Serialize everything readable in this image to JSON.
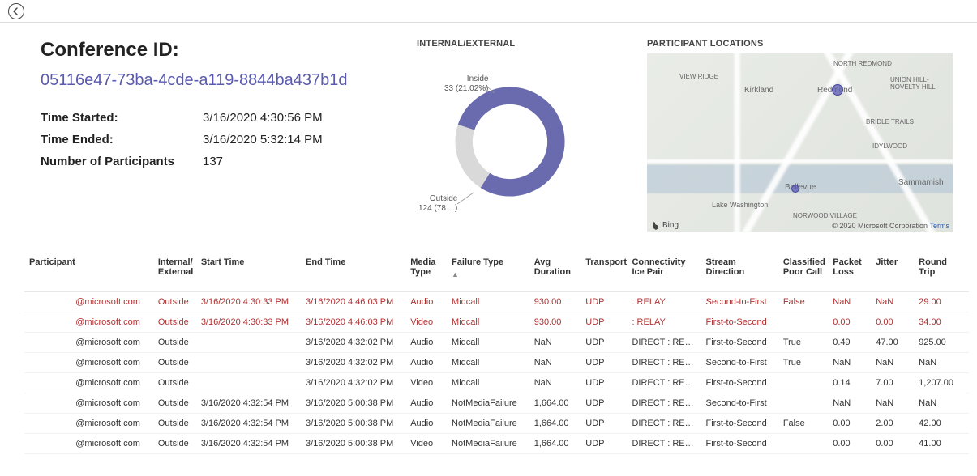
{
  "header": {
    "conf_label": "Conference ID:",
    "conf_id": "05116e47-73ba-4cde-a119-8844ba437b1d",
    "time_started_label": "Time Started:",
    "time_started": "3/16/2020 4:30:56 PM",
    "time_ended_label": "Time Ended:",
    "time_ended": "3/16/2020 5:32:14 PM",
    "num_participants_label": "Number of Participants",
    "num_participants": "137"
  },
  "donut": {
    "title": "INTERNAL/EXTERNAL",
    "inside_label": "Inside",
    "inside_stat": "33 (21.02%)",
    "outside_label": "Outside",
    "outside_stat": "124 (78....)"
  },
  "map": {
    "title": "PARTICIPANT LOCATIONS",
    "attrib": "Bing",
    "copy": "© 2020 Microsoft Corporation",
    "terms": "Terms",
    "cities": {
      "viewridge": "VIEW RIDGE",
      "kirkland": "Kirkland",
      "redmond": "Redmond",
      "bellevue": "Bellevue",
      "sammamish": "Sammamish",
      "lakewa": "Lake Washington",
      "bridle": "BRIDLE TRAILS",
      "idyl": "IDYLWOOD",
      "norw": "NORWOOD VILLAGE",
      "northRedmond": "NORTH REDMOND",
      "unionHill": "UNION HILL-NOVELTY HILL"
    }
  },
  "chart_data": {
    "type": "pie",
    "title": "INTERNAL/EXTERNAL",
    "series": [
      {
        "name": "Inside",
        "value": 33,
        "percent": 21.02
      },
      {
        "name": "Outside",
        "value": 124,
        "percent": 78.98
      }
    ]
  },
  "table": {
    "columns": {
      "participant": "Participant",
      "internal_external": "Internal/\nExternal",
      "start_time": "Start Time",
      "end_time": "End Time",
      "media_type": "Media Type",
      "failure_type": "Failure Type",
      "avg_duration": "Avg Duration",
      "transport": "Transport",
      "connectivity": "Connectivity Ice Pair",
      "stream_direction": "Stream Direction",
      "classified_poor": "Classified Poor Call",
      "packet_loss": "Packet Loss",
      "jitter": "Jitter",
      "round_trip": "Round Trip"
    },
    "sort_indicator": "▲",
    "rows": [
      {
        "red": true,
        "participant": "@microsoft.com",
        "ie": "Outside",
        "start": "3/16/2020 4:30:33 PM",
        "end": "3/16/2020 4:46:03 PM",
        "mt": "Audio",
        "ft": "Midcall",
        "ad": "930.00",
        "tr": "UDP",
        "cp": ": RELAY",
        "sd": "Second-to-First",
        "cpc": "False",
        "pl": "NaN",
        "ji": "NaN",
        "rt": "29.00"
      },
      {
        "red": true,
        "participant": "@microsoft.com",
        "ie": "Outside",
        "start": "3/16/2020 4:30:33 PM",
        "end": "3/16/2020 4:46:03 PM",
        "mt": "Video",
        "ft": "Midcall",
        "ad": "930.00",
        "tr": "UDP",
        "cp": ": RELAY",
        "sd": "First-to-Second",
        "cpc": "",
        "pl": "0.00",
        "ji": "0.00",
        "rt": "34.00"
      },
      {
        "red": false,
        "participant": "@microsoft.com",
        "ie": "Outside",
        "start": "",
        "end": "3/16/2020 4:32:02 PM",
        "mt": "Audio",
        "ft": "Midcall",
        "ad": "NaN",
        "tr": "UDP",
        "cp": "DIRECT : RELAY",
        "sd": "First-to-Second",
        "cpc": "True",
        "pl": "0.49",
        "ji": "47.00",
        "rt": "925.00"
      },
      {
        "red": false,
        "participant": "@microsoft.com",
        "ie": "Outside",
        "start": "",
        "end": "3/16/2020 4:32:02 PM",
        "mt": "Audio",
        "ft": "Midcall",
        "ad": "NaN",
        "tr": "UDP",
        "cp": "DIRECT : RELAY",
        "sd": "Second-to-First",
        "cpc": "True",
        "pl": "NaN",
        "ji": "NaN",
        "rt": "NaN"
      },
      {
        "red": false,
        "participant": "@microsoft.com",
        "ie": "Outside",
        "start": "",
        "end": "3/16/2020 4:32:02 PM",
        "mt": "Video",
        "ft": "Midcall",
        "ad": "NaN",
        "tr": "UDP",
        "cp": "DIRECT : RELAY",
        "sd": "First-to-Second",
        "cpc": "",
        "pl": "0.14",
        "ji": "7.00",
        "rt": "1,207.00"
      },
      {
        "red": false,
        "participant": "@microsoft.com",
        "ie": "Outside",
        "start": "3/16/2020 4:32:54 PM",
        "end": "3/16/2020 5:00:38 PM",
        "mt": "Audio",
        "ft": "NotMediaFailure",
        "ad": "1,664.00",
        "tr": "UDP",
        "cp": "DIRECT : RELAY",
        "sd": "Second-to-First",
        "cpc": "",
        "pl": "NaN",
        "ji": "NaN",
        "rt": "NaN"
      },
      {
        "red": false,
        "participant": "@microsoft.com",
        "ie": "Outside",
        "start": "3/16/2020 4:32:54 PM",
        "end": "3/16/2020 5:00:38 PM",
        "mt": "Audio",
        "ft": "NotMediaFailure",
        "ad": "1,664.00",
        "tr": "UDP",
        "cp": "DIRECT : RELAY",
        "sd": "First-to-Second",
        "cpc": "False",
        "pl": "0.00",
        "ji": "2.00",
        "rt": "42.00"
      },
      {
        "red": false,
        "participant": "@microsoft.com",
        "ie": "Outside",
        "start": "3/16/2020 4:32:54 PM",
        "end": "3/16/2020 5:00:38 PM",
        "mt": "Video",
        "ft": "NotMediaFailure",
        "ad": "1,664.00",
        "tr": "UDP",
        "cp": "DIRECT : RELAY",
        "sd": "First-to-Second",
        "cpc": "",
        "pl": "0.00",
        "ji": "0.00",
        "rt": "41.00"
      }
    ]
  }
}
